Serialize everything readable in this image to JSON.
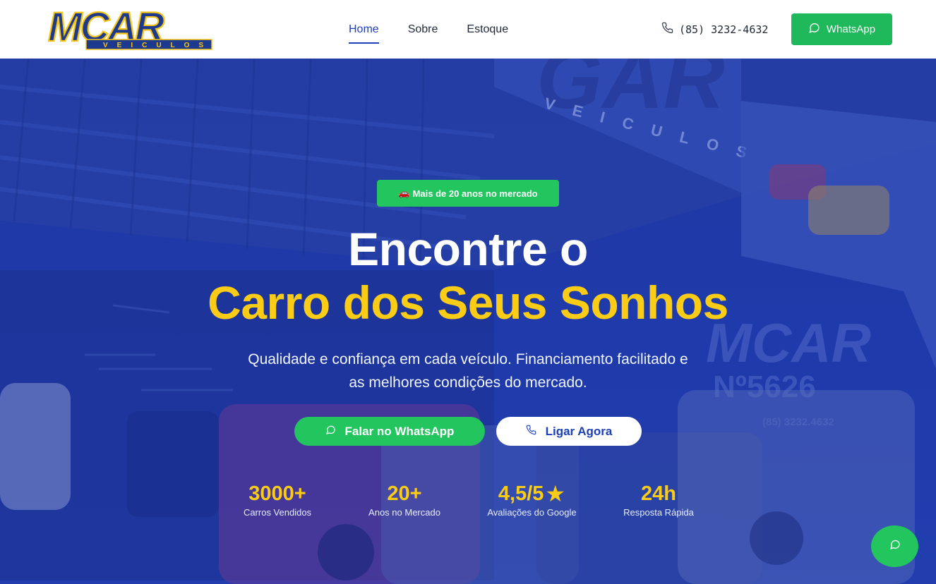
{
  "brand": {
    "logo_main": "MCAR",
    "logo_sub": "VEICULOS",
    "colors": {
      "primary": "#1d3fb8",
      "accent": "#facc15",
      "green": "#22c55e"
    }
  },
  "nav": {
    "items": [
      {
        "label": "Home",
        "active": true
      },
      {
        "label": "Sobre",
        "active": false
      },
      {
        "label": "Estoque",
        "active": false
      }
    ]
  },
  "header": {
    "phone": "(85) 3232-4632",
    "phone_icon": "phone-icon",
    "whatsapp_label": "WhatsApp",
    "whatsapp_icon": "chat-bubble-icon"
  },
  "hero": {
    "badge": "Mais de 20 anos no mercado",
    "badge_icon": "car-icon",
    "title_line1": "Encontre o",
    "title_line2": "Carro dos Seus Sonhos",
    "subtitle_line1": "Qualidade e confiança em cada veículo. Financiamento facilitado e",
    "subtitle_line2": "as melhores condições do mercado.",
    "cta_whatsapp": "Falar no WhatsApp",
    "cta_call": "Ligar Agora",
    "background_sign": {
      "main": "MCAR",
      "sub": "VEICULOS",
      "number": "Nº5626",
      "phone": "(85) 3232.4632"
    },
    "stats": [
      {
        "value": "3000+",
        "label": "Carros Vendidos"
      },
      {
        "value": "20+",
        "label": "Anos no Mercado"
      },
      {
        "value": "4,5/5",
        "label": "Avaliações do Google",
        "icon": "star-icon"
      },
      {
        "value": "24h",
        "label": "Resposta Rápida"
      }
    ]
  },
  "floating": {
    "icon": "chat-bubble-icon"
  }
}
